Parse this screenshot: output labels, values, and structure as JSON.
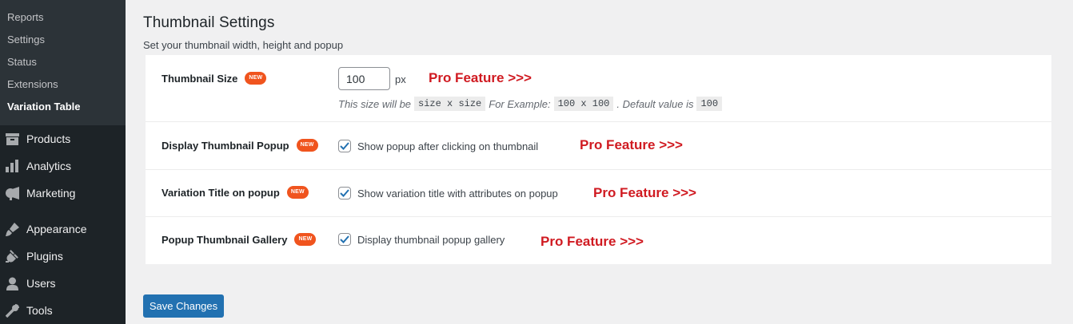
{
  "sidebar": {
    "submenu": [
      {
        "label": "Reports"
      },
      {
        "label": "Settings"
      },
      {
        "label": "Status"
      },
      {
        "label": "Extensions"
      },
      {
        "label": "Variation Table"
      }
    ],
    "menu": [
      {
        "label": "Products",
        "icon": "archive-icon"
      },
      {
        "label": "Analytics",
        "icon": "bar-chart-icon"
      },
      {
        "label": "Marketing",
        "icon": "megaphone-icon"
      },
      {
        "label": "Appearance",
        "icon": "paintbrush-icon"
      },
      {
        "label": "Plugins",
        "icon": "plug-icon"
      },
      {
        "label": "Users",
        "icon": "user-icon"
      },
      {
        "label": "Tools",
        "icon": "wrench-icon"
      }
    ]
  },
  "page": {
    "title": "Thumbnail Settings",
    "description": "Set your thumbnail width, height and popup"
  },
  "settings": {
    "thumbnail_size": {
      "label": "Thumbnail Size",
      "badge": "NEW",
      "value": "100",
      "unit": "px",
      "pro": "Pro Feature >>>",
      "help_prefix": "This size will be",
      "help_code1": "size x size",
      "help_mid": "For Example:",
      "help_code2": "100 x 100",
      "help_suffix": ". Default value is",
      "help_code3": "100"
    },
    "display_popup": {
      "label": "Display Thumbnail Popup",
      "badge": "NEW",
      "checkbox_label": "Show popup after clicking on thumbnail",
      "checked": true,
      "pro": "Pro Feature >>>"
    },
    "variation_title": {
      "label": "Variation Title on popup",
      "badge": "NEW",
      "checkbox_label": "Show variation title with attributes on popup",
      "checked": true,
      "pro": "Pro Feature >>>"
    },
    "popup_gallery": {
      "label": "Popup Thumbnail Gallery",
      "badge": "NEW",
      "checkbox_label": "Display thumbnail popup gallery",
      "checked": true,
      "pro": "Pro Feature >>>"
    }
  },
  "save_button": "Save Changes",
  "colors": {
    "sidebar_bg": "#1d2327",
    "submenu_bg": "#2c3338",
    "accent": "#2271b1",
    "badge": "#f0541e",
    "pro": "#d01a21"
  }
}
